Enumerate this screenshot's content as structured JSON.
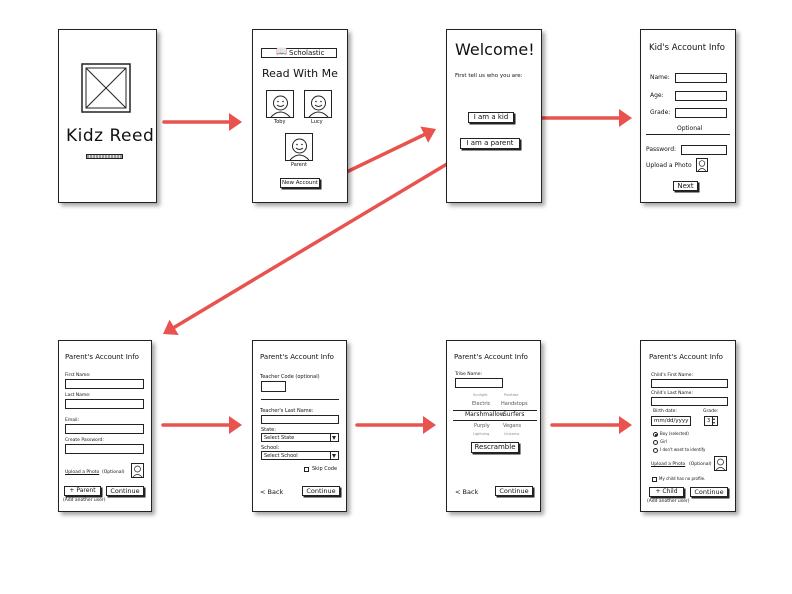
{
  "colors": {
    "arrow": "#e8534f",
    "stroke": "#222222",
    "placeholder_fill": "#d9d9d9"
  },
  "screen1": {
    "title": "Kidz Reed",
    "image_icon": "image-placeholder-icon"
  },
  "screen2": {
    "header": "Scholastic",
    "title": "Read With Me",
    "users": [
      "Toby",
      "Lucy",
      "Parent"
    ],
    "new_account": "New Account"
  },
  "screen3": {
    "title": "Welcome!",
    "prompt": "First tell us who you are:",
    "kid_button": "I am a kid",
    "parent_button": "I am a parent"
  },
  "screen4": {
    "title": "Kid's Account Info",
    "name_label": "Name:",
    "age_label": "Age:",
    "grade_label": "Grade:",
    "optional": "Optional",
    "password_label": "Password:",
    "photo_label": "Upload a Photo",
    "next": "Next"
  },
  "screen5": {
    "title": "Parent's Account Info",
    "first_name": "First Name:",
    "last_name": "Last Name:",
    "email": "Email:",
    "password": "Create Password:",
    "upload": "Upload a Photo",
    "optional": "(Optional)",
    "add_parent": "+ Parent",
    "continue": "Continue",
    "add_user": "(Add another user)"
  },
  "screen6": {
    "title": "Parent's Account Info",
    "teacher_code": "Teacher Code (optional)",
    "teacher_last": "Teacher's Last Name:",
    "state": "State:",
    "state_select": "Select State",
    "school": "School:",
    "school_select": "Select School",
    "skip": "Skip Code",
    "back": "< Back",
    "continue": "Continue"
  },
  "screen7": {
    "title": "Parent's Account Info",
    "tribe_name": "Tribe Name:",
    "names": [
      [
        "Sunlight",
        "Pinetree"
      ],
      [
        "Electric",
        "Handstops"
      ],
      [
        "Marshmallow",
        "Surfers"
      ],
      [
        "Purply",
        "Vegans"
      ],
      [
        "Lightning",
        "Unicorns"
      ]
    ],
    "button": "Rescramble",
    "back": "< Back",
    "continue": "Continue"
  },
  "screen8": {
    "title": "Parent's Account Info",
    "child_first": "Child's First Name:",
    "child_last": "Child's Last Name:",
    "birth_date": "Birth date:",
    "grade": "Grade:",
    "date_placeholder": "mm/dd/yyyy",
    "grade_value": "3",
    "gender_options": [
      "Boy (selected)",
      "Girl",
      "I don't want to identify"
    ],
    "upload": "Upload a Photo",
    "optional": "(Optional)",
    "photo_check": "My child has no profile.",
    "add_child": "+ Child",
    "continue": "Continue",
    "add_user": "(Add another user)"
  }
}
